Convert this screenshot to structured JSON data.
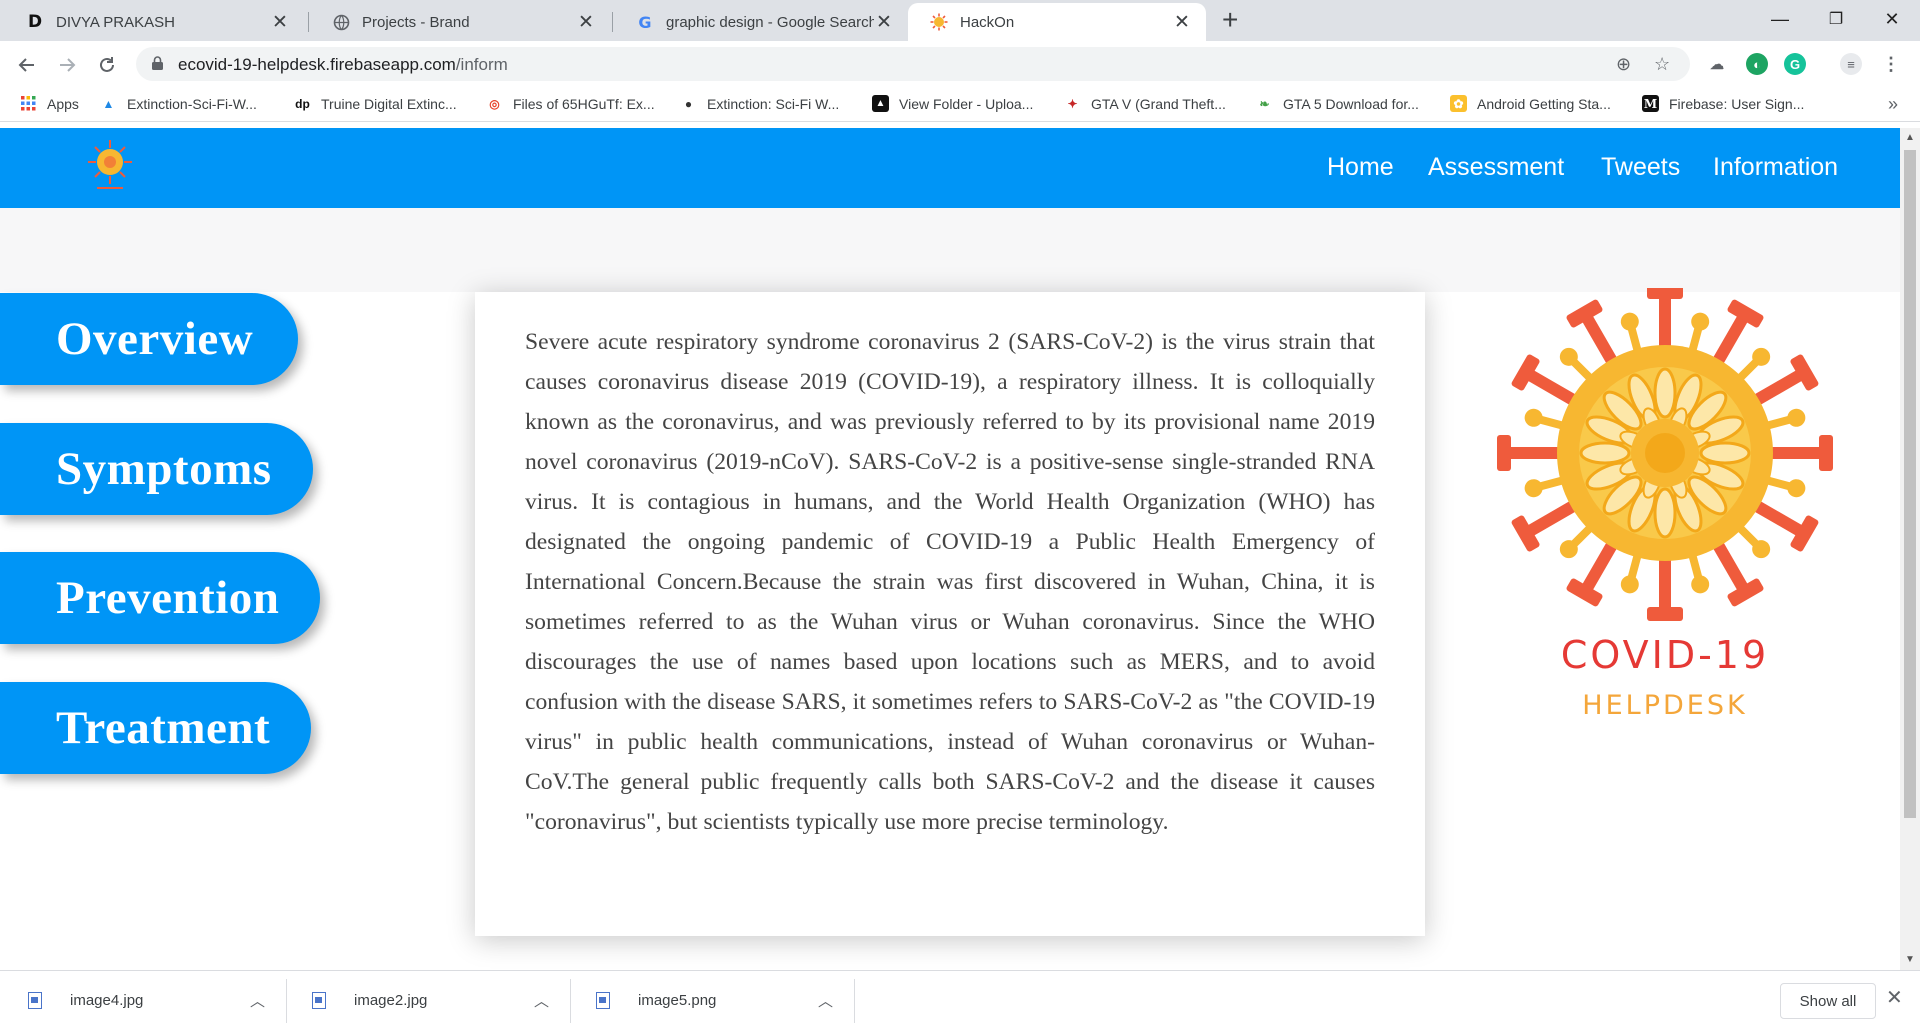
{
  "browser": {
    "tabs": [
      {
        "title": "DIVYA PRAKASH",
        "favicon": "D",
        "active": false
      },
      {
        "title": "Projects - Brand",
        "favicon": "globe-icon",
        "active": false
      },
      {
        "title": "graphic design - Google Search",
        "favicon": "G",
        "active": false
      },
      {
        "title": "HackOn",
        "favicon": "virus-icon",
        "active": true
      }
    ],
    "new_tab": "+",
    "window_controls": {
      "minimize": "—",
      "restore": "❐",
      "close": "✕"
    },
    "url_host": "ecovid-19-helpdesk.firebaseapp.com",
    "url_path": "/inform",
    "bookmarks": [
      {
        "label": "Apps",
        "icon": "apps-grid-icon"
      },
      {
        "label": "Extinction-Sci-Fi-W...",
        "icon": "triangle-icon"
      },
      {
        "label": "Truine Digital Extinc...",
        "icon": "dp-icon"
      },
      {
        "label": "Files of 65HGuTf: Ex...",
        "icon": "compass-icon"
      },
      {
        "label": "Extinction: Sci-Fi W...",
        "icon": "globe-icon"
      },
      {
        "label": "View Folder - Uploa...",
        "icon": "upload-icon"
      },
      {
        "label": "GTA V (Grand Theft...",
        "icon": "gamepad-icon"
      },
      {
        "label": "GTA 5 Download for...",
        "icon": "leaf-icon"
      },
      {
        "label": "Android Getting Sta...",
        "icon": "android-icon"
      },
      {
        "label": "Firebase: User Sign...",
        "icon": "m-icon"
      }
    ],
    "bookmarks_more": "»"
  },
  "site": {
    "nav": [
      "Home",
      "Assessment",
      "Tweets",
      "Information"
    ],
    "sidebar": [
      "Overview",
      "Symptoms",
      "Prevention",
      "Treatment"
    ],
    "article": "Severe acute respiratory syndrome coronavirus 2 (SARS-CoV-2) is the virus strain that causes coronavirus disease 2019 (COVID-19), a respiratory illness. It is colloquially known as the coronavirus, and was previously referred to by its provisional name 2019 novel coronavirus (2019-nCoV). SARS-CoV-2 is a positive-sense single-stranded RNA virus. It is contagious in humans, and the World Health Organization (WHO) has designated the ongoing pandemic of COVID-19 a Public Health Emergency of International Concern.Because the strain was first discovered in Wuhan, China, it is sometimes referred to as the Wuhan virus or Wuhan coronavirus. Since the WHO discourages the use of names based upon locations such as MERS, and to avoid confusion with the disease SARS, it sometimes refers to SARS-CoV-2 as \"the COVID-19 virus\" in public health communications, instead of Wuhan coronavirus or Wuhan-CoV.The general public frequently calls both SARS-CoV-2 and the disease it causes \"coronavirus\", but scientists typically use more precise terminology.",
    "brand_title": "COVID-19",
    "brand_subtitle": "HELPDESK",
    "colors": {
      "primary": "#0095f6",
      "virus_red": "#ef5b3c",
      "virus_yellow": "#f7b731",
      "brand_red": "#e53935",
      "brand_orange": "#f4a63a"
    }
  },
  "downloads": {
    "files": [
      "image4.jpg",
      "image2.jpg",
      "image5.png"
    ],
    "show_all": "Show all"
  }
}
